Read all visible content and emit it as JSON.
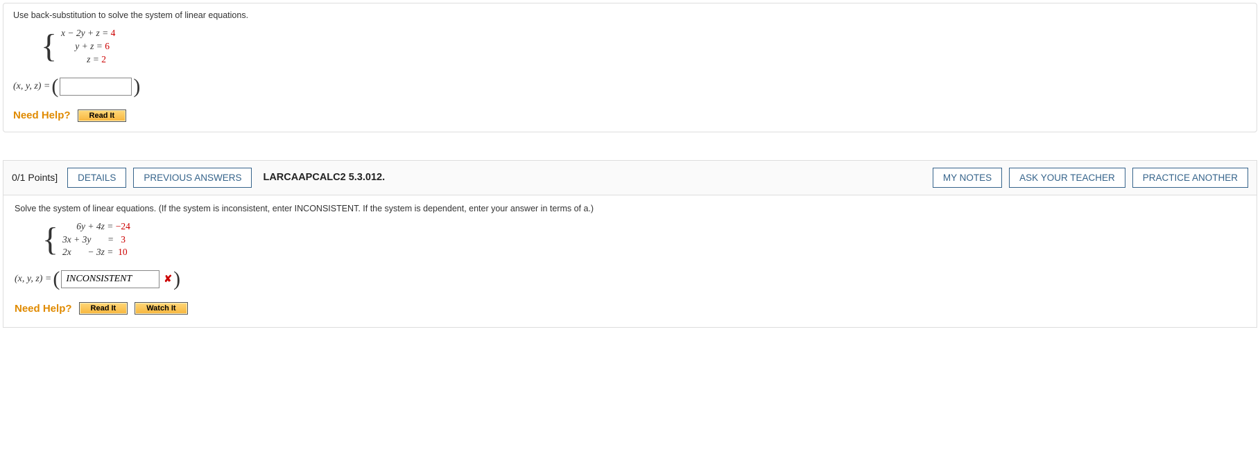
{
  "q1": {
    "instruction": "Use back-substitution to solve the system of linear equations.",
    "eq1_lhs": "x − 2y + z = ",
    "eq1_rhs": "4",
    "eq2_lhs": "y + z = ",
    "eq2_rhs": "6",
    "eq3_lhs": "z = ",
    "eq3_rhs": "2",
    "answer_label": "(x, y, z) = ",
    "answer_value": "",
    "need_help": "Need Help?",
    "read_it": "Read It"
  },
  "chart_data": {
    "type": "table",
    "title": "System of linear equations (Question 1)",
    "equations": [
      {
        "x": 1,
        "y": -2,
        "z": 1,
        "rhs": 4
      },
      {
        "x": 0,
        "y": 1,
        "z": 1,
        "rhs": 6
      },
      {
        "x": 0,
        "y": 0,
        "z": 1,
        "rhs": 2
      }
    ]
  },
  "q2": {
    "points": "0/1 Points]",
    "details_btn": "DETAILS",
    "prev_btn": "PREVIOUS ANSWERS",
    "reference": "LARCAAPCALC2 5.3.012.",
    "mynotes_btn": "MY NOTES",
    "askteacher_btn": "ASK YOUR TEACHER",
    "practice_btn": "PRACTICE ANOTHER",
    "instruction": "Solve the system of linear equations. (If the system is inconsistent, enter INCONSISTENT. If the system is dependent, enter your answer in terms of a.)",
    "eq1_lhs": "      6y + 4z = ",
    "eq1_rhs": "−24",
    "eq2_lhs": "3x + 3y       =   ",
    "eq2_rhs": "3",
    "eq3_lhs": "2x       − 3z =  ",
    "eq3_rhs": "10",
    "answer_label": "(x, y, z) = ",
    "answer_value": "INCONSISTENT",
    "wrong_mark": "✘",
    "need_help": "Need Help?",
    "read_it": "Read It",
    "watch_it": "Watch It"
  },
  "chart_data_q2": {
    "type": "table",
    "title": "System of linear equations (Question 2)",
    "equations": [
      {
        "x": 0,
        "y": 6,
        "z": 4,
        "rhs": -24
      },
      {
        "x": 3,
        "y": 3,
        "z": 0,
        "rhs": 3
      },
      {
        "x": 2,
        "y": 0,
        "z": -3,
        "rhs": 10
      }
    ]
  }
}
